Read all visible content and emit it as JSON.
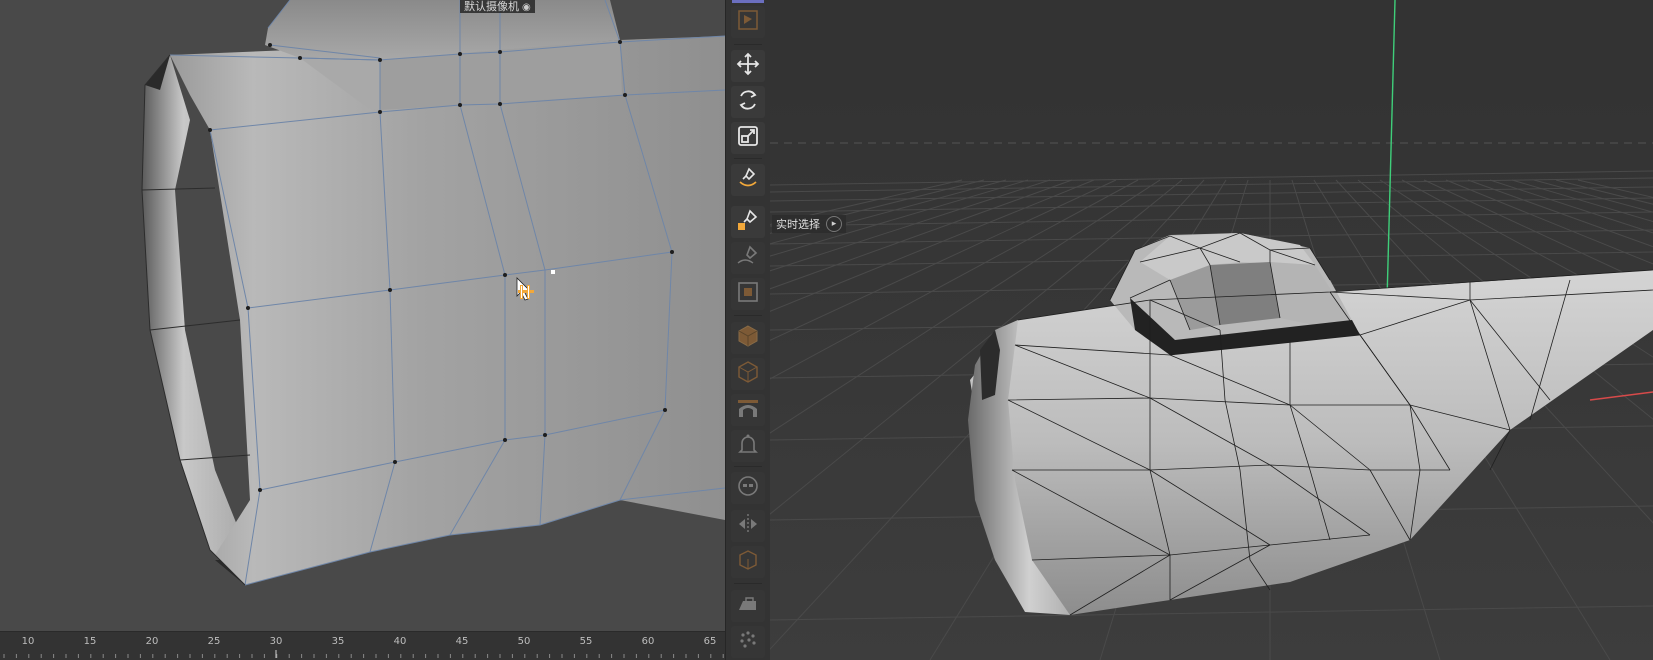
{
  "left_viewport": {
    "camera_label": "默认摄像机",
    "camera_icon": "camera-icon",
    "timeline_ticks": [
      "10",
      "15",
      "20",
      "25",
      "30",
      "35",
      "40",
      "45",
      "50",
      "55",
      "60",
      "65"
    ]
  },
  "toolbar": {
    "tools": [
      {
        "icon": "render-region-icon",
        "active": false
      },
      {
        "icon": "move-icon",
        "active": true
      },
      {
        "icon": "rotate-icon",
        "active": true
      },
      {
        "icon": "scale-icon",
        "active": true
      },
      {
        "icon": "brush-smile-icon",
        "active": true
      },
      {
        "icon": "live-select-icon",
        "active": true
      },
      {
        "icon": "lasso-select-icon",
        "active": false
      },
      {
        "icon": "polygon-select-icon",
        "active": false
      },
      {
        "icon": "cube-orange-icon",
        "active": false
      },
      {
        "icon": "cube-wire-icon",
        "active": false
      },
      {
        "icon": "arch-icon",
        "active": false
      },
      {
        "icon": "bell-icon",
        "active": false
      },
      {
        "icon": "mask-icon",
        "active": false
      },
      {
        "icon": "mirror-icon",
        "active": false
      },
      {
        "icon": "box-icon",
        "active": false
      },
      {
        "icon": "iron-icon",
        "active": false
      },
      {
        "icon": "dots-icon",
        "active": false
      }
    ]
  },
  "right_viewport": {
    "tooltip": "实时选择",
    "tooltip_icon": "help-icon",
    "axis_colors": {
      "y": "#3fcf7a",
      "x": "#d84a4a"
    }
  }
}
